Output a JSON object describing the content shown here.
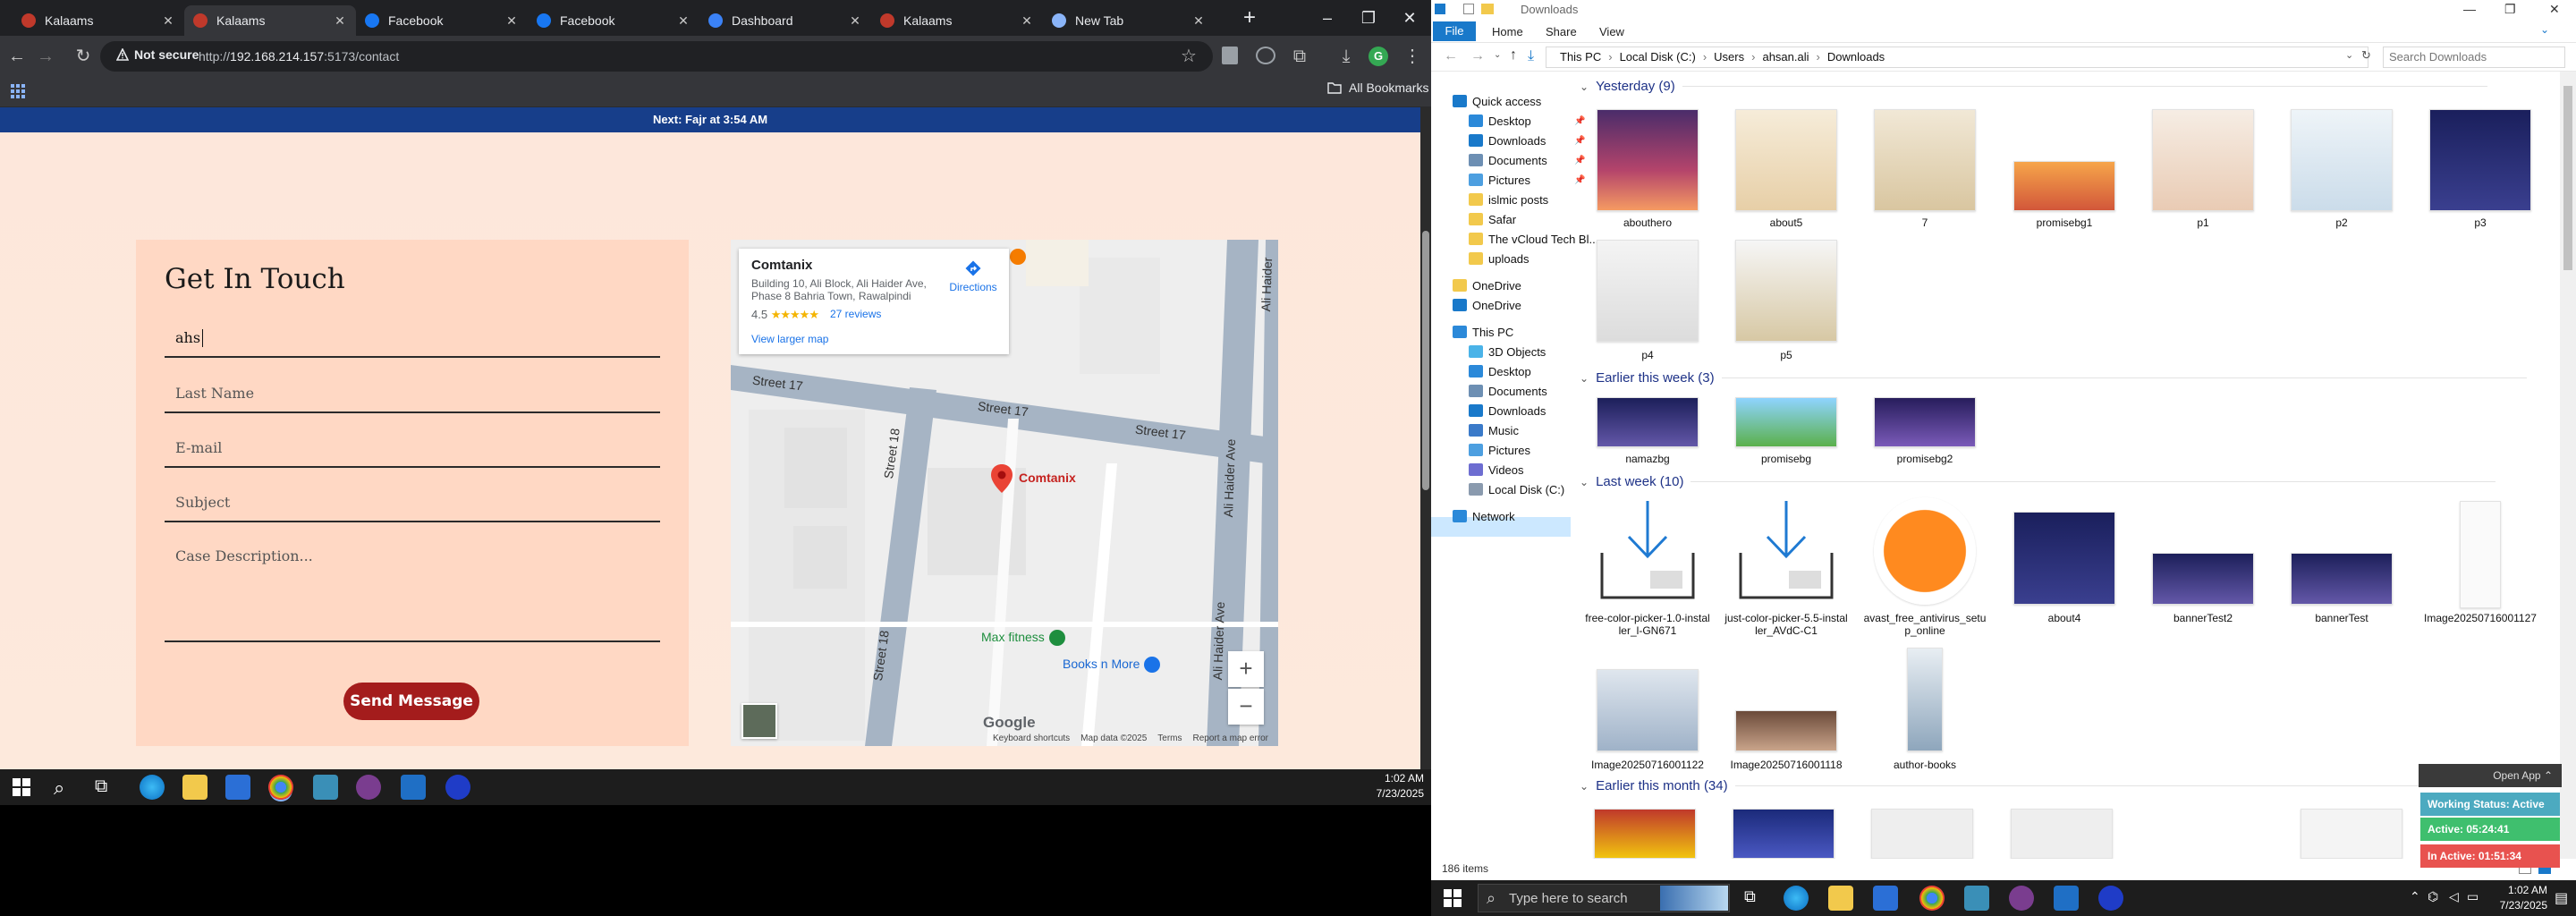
{
  "chrome": {
    "tabs": [
      {
        "label": "Kalaams",
        "favicon": "kalaams-icon",
        "active": false
      },
      {
        "label": "Kalaams",
        "favicon": "kalaams-icon",
        "active": true
      },
      {
        "label": "Facebook",
        "favicon": "facebook-icon",
        "active": false
      },
      {
        "label": "Facebook",
        "favicon": "facebook-icon",
        "active": false
      },
      {
        "label": "Dashboard",
        "favicon": "dashboard-icon",
        "active": false
      },
      {
        "label": "Kalaams",
        "favicon": "kalaams-icon",
        "active": false
      },
      {
        "label": "New Tab",
        "favicon": "chrome-icon",
        "active": false
      }
    ],
    "not_secure": "Not secure",
    "url_prefix": "http://",
    "url_host": "192.168.214.157",
    "url_rest": ":5173/contact",
    "profile_initial": "G",
    "all_bookmarks": "All Bookmarks"
  },
  "page": {
    "prayer": "Next: Fajr at 3:54 AM",
    "form": {
      "title": "Get In Touch",
      "first_name_value": "ahs",
      "last_name_placeholder": "Last Name",
      "email_placeholder": "E-mail",
      "subject_placeholder": "Subject",
      "description_placeholder": "Case Description...",
      "send_label": "Send Message"
    },
    "map": {
      "place_name": "Comtanix",
      "address": "Building 10, Ali Block, Ali Haider Ave, Phase 8 Bahria Town, Rawalpindi",
      "rating": "4.5",
      "stars": "★★★★★",
      "reviews": "27 reviews",
      "view_larger": "View larger map",
      "directions": "Directions",
      "street_labels": [
        "Street 17",
        "Street 17",
        "Street 17",
        "Street 18",
        "Street 18",
        "Ali Haider Ave",
        "Ali Haider Ave",
        "Ali Haider"
      ],
      "poi_pin": "Comtanix",
      "poi_fitness": "Max fitness",
      "poi_books": "Books n More",
      "google": "Google",
      "footer": [
        "Keyboard shortcuts",
        "Map data ©2025",
        "Terms",
        "Report a map error"
      ]
    }
  },
  "left_taskbar": {
    "time": "1:02 AM",
    "date": "7/23/2025"
  },
  "explorer": {
    "title": "Downloads",
    "ribbon_tabs": [
      "File",
      "Home",
      "Share",
      "View"
    ],
    "breadcrumb": [
      "This PC",
      "Local Disk (C:)",
      "Users",
      "ahsan.ali",
      "Downloads"
    ],
    "search_placeholder": "Search Downloads",
    "nav": [
      {
        "label": "Quick access",
        "icon": "star-icon",
        "pinned": false
      },
      {
        "label": "Desktop",
        "icon": "desktop-icon",
        "pinned": true
      },
      {
        "label": "Downloads",
        "icon": "download-icon",
        "pinned": true
      },
      {
        "label": "Documents",
        "icon": "documents-icon",
        "pinned": true
      },
      {
        "label": "Pictures",
        "icon": "pictures-icon",
        "pinned": true
      },
      {
        "label": "islmic posts",
        "icon": "folder-icon",
        "pinned": false
      },
      {
        "label": "Safar",
        "icon": "folder-icon",
        "pinned": false
      },
      {
        "label": "The vCloud Tech Bl...",
        "icon": "folder-icon",
        "pinned": false
      },
      {
        "label": "uploads",
        "icon": "folder-icon",
        "pinned": false
      },
      {
        "label": "OneDrive",
        "icon": "folder-icon",
        "pinned": false
      },
      {
        "label": "OneDrive",
        "icon": "cloud-icon",
        "pinned": false
      },
      {
        "label": "This PC",
        "icon": "computer-icon",
        "pinned": false
      },
      {
        "label": "3D Objects",
        "icon": "cube-icon",
        "pinned": false
      },
      {
        "label": "Desktop",
        "icon": "desktop-icon",
        "pinned": false
      },
      {
        "label": "Documents",
        "icon": "documents-icon",
        "pinned": false
      },
      {
        "label": "Downloads",
        "icon": "download-icon",
        "pinned": false
      },
      {
        "label": "Music",
        "icon": "music-icon",
        "pinned": false
      },
      {
        "label": "Pictures",
        "icon": "pictures-icon",
        "pinned": false
      },
      {
        "label": "Videos",
        "icon": "videos-icon",
        "pinned": false
      },
      {
        "label": "Local Disk (C:)",
        "icon": "disk-icon",
        "pinned": false
      },
      {
        "label": "Network",
        "icon": "network-icon",
        "pinned": false
      }
    ],
    "groups": [
      {
        "title": "Yesterday (9)"
      },
      {
        "title": "Earlier this week (3)"
      },
      {
        "title": "Last week (10)"
      },
      {
        "title": "Earlier this month (34)"
      }
    ],
    "files": [
      {
        "name": "abouthero",
        "group": 0
      },
      {
        "name": "about5",
        "group": 0
      },
      {
        "name": "7",
        "group": 0
      },
      {
        "name": "promisebg1",
        "group": 0
      },
      {
        "name": "p1",
        "group": 0
      },
      {
        "name": "p2",
        "group": 0
      },
      {
        "name": "p3",
        "group": 0
      },
      {
        "name": "p4",
        "group": 0
      },
      {
        "name": "p5",
        "group": 0
      },
      {
        "name": "namazbg",
        "group": 1
      },
      {
        "name": "promisebg",
        "group": 1
      },
      {
        "name": "promisebg2",
        "group": 1
      },
      {
        "name": "free-color-picker-1.0-installer_l-GN671",
        "group": 2
      },
      {
        "name": "just-color-picker-5.5-installer_AVdC-C1",
        "group": 2
      },
      {
        "name": "avast_free_antivirus_setup_online",
        "group": 2
      },
      {
        "name": "about4",
        "group": 2
      },
      {
        "name": "bannerTest2",
        "group": 2
      },
      {
        "name": "bannerTest",
        "group": 2
      },
      {
        "name": "Image20250716001127",
        "group": 2
      },
      {
        "name": "Image20250716001122",
        "group": 2
      },
      {
        "name": "Image20250716001118",
        "group": 2
      },
      {
        "name": "author-books",
        "group": 2
      }
    ],
    "item_count": "186 items",
    "widget": {
      "open_app": "Open App",
      "status": "Working Status: Active",
      "active": "Active: 05:24:41",
      "inactive": "In Active: 01:51:34"
    }
  },
  "right_taskbar": {
    "search_placeholder": "Type here to search",
    "time": "1:02 AM",
    "date": "7/23/2025"
  }
}
